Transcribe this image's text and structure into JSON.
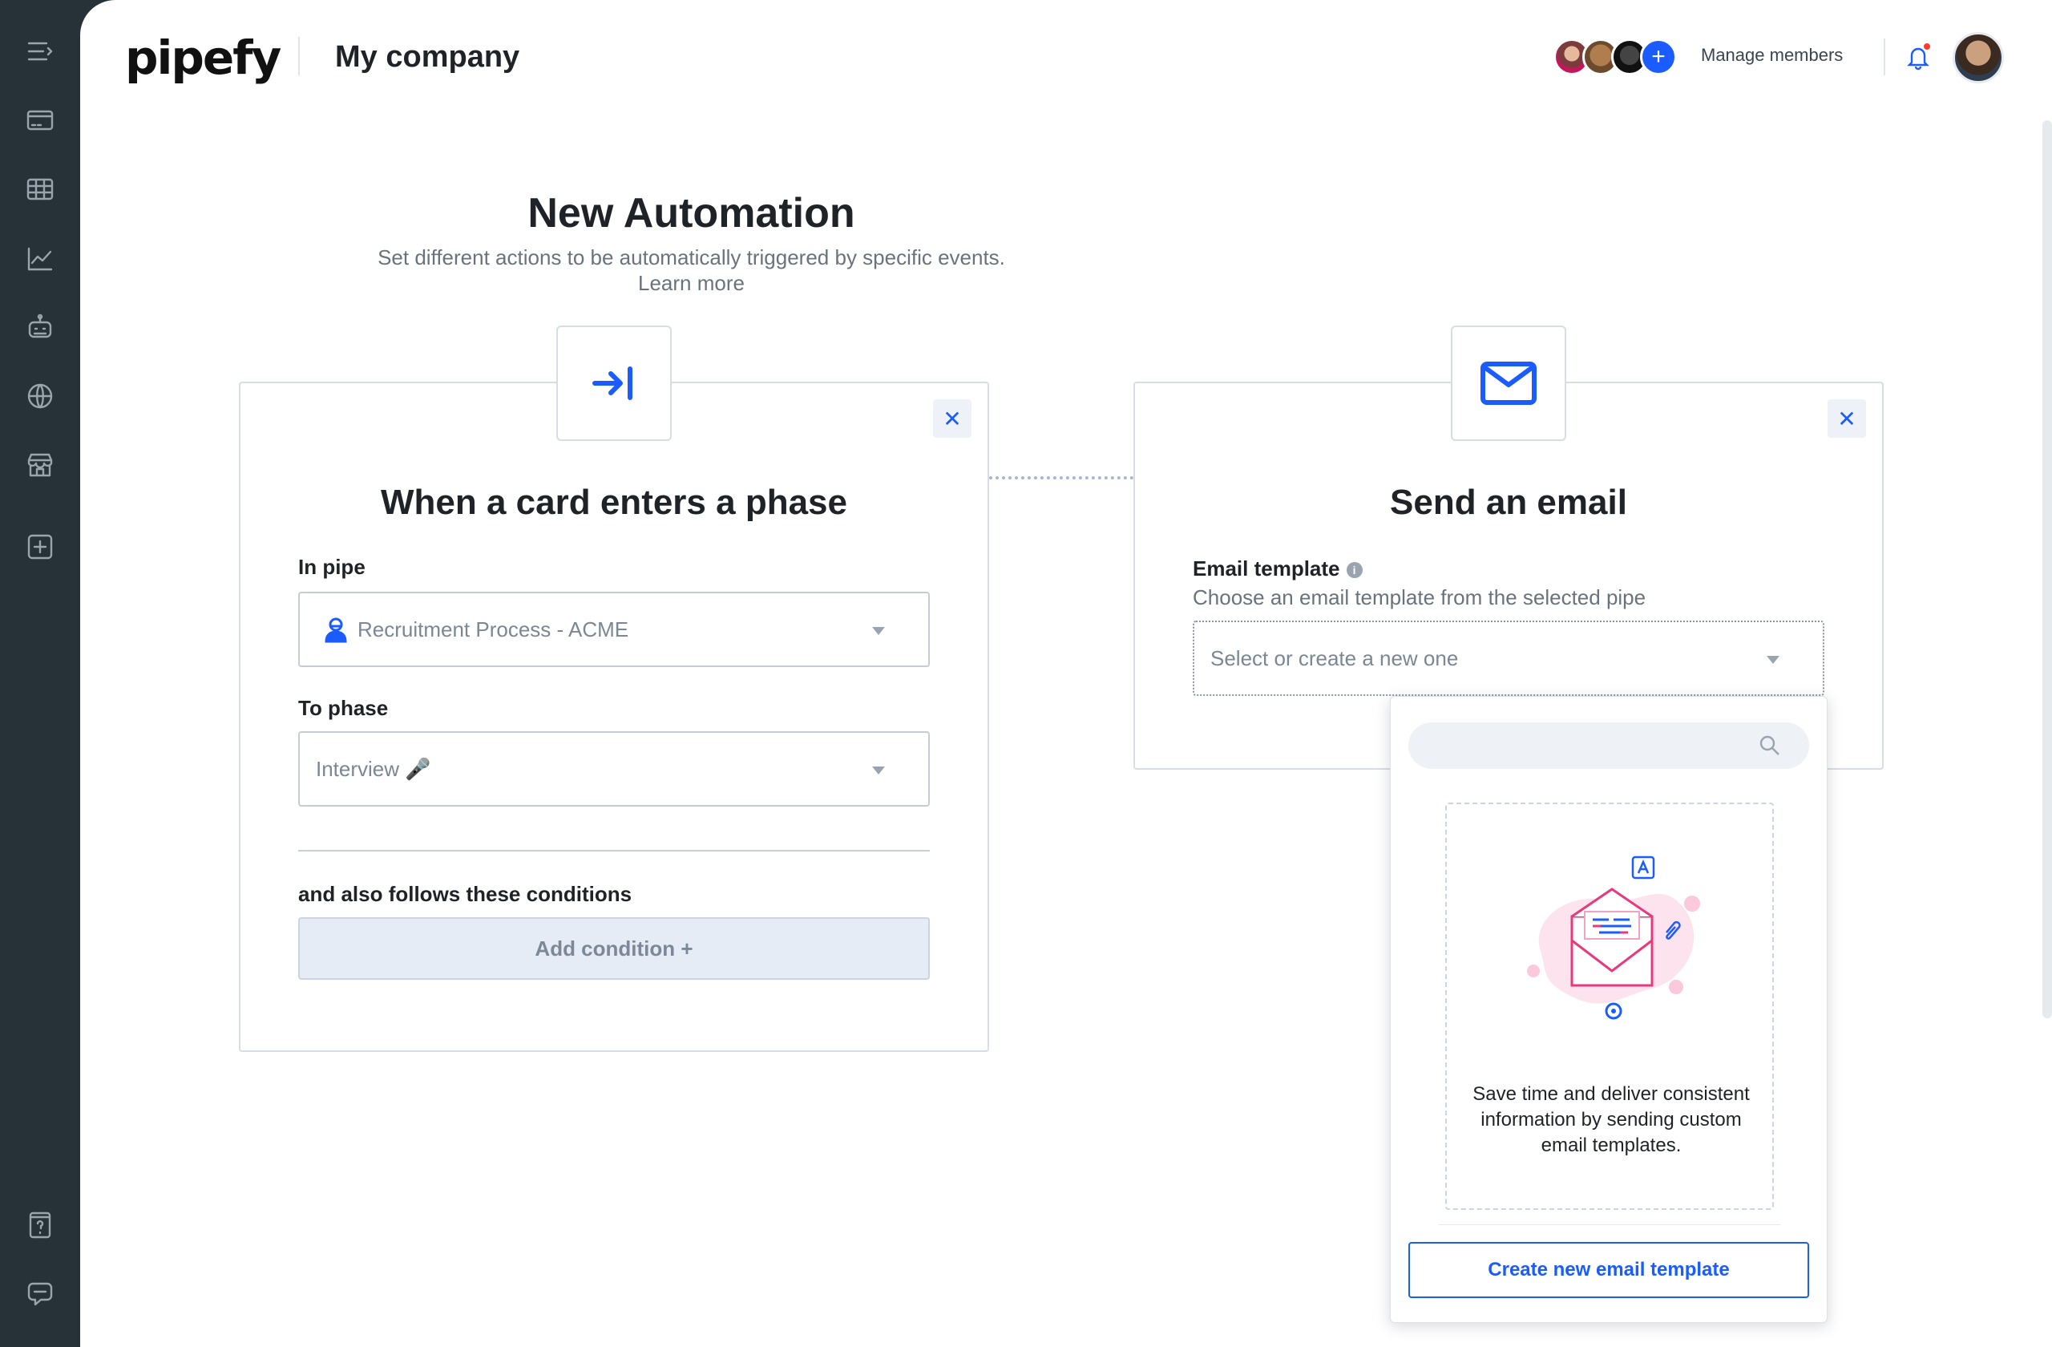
{
  "app": {
    "logo_text": "pipefy",
    "company_name": "My company"
  },
  "sidebar": {
    "items": [
      {
        "icon": "menu-expand-icon"
      },
      {
        "icon": "card-icon"
      },
      {
        "icon": "table-icon"
      },
      {
        "icon": "chart-icon"
      },
      {
        "icon": "robot-icon"
      },
      {
        "icon": "globe-icon"
      },
      {
        "icon": "store-icon"
      },
      {
        "icon": "add-square-icon"
      },
      {
        "icon": "help-icon"
      },
      {
        "icon": "chat-icon"
      }
    ]
  },
  "header": {
    "manage_members": "Manage members",
    "add_member_symbol": "+",
    "notification_dot_color": "#ff3b30"
  },
  "page": {
    "title": "New Automation",
    "subtitle": "Set different actions to be automatically triggered by specific events.",
    "learn_more": "Learn more"
  },
  "trigger": {
    "title": "When a card enters a phase",
    "close_symbol": "✕",
    "pipe_label": "In pipe",
    "pipe_value": "Recruitment Process - ACME",
    "phase_label": "To phase",
    "phase_value": "Interview 🎤",
    "conditions_label": "and also follows these conditions",
    "add_condition": "Add condition +"
  },
  "action": {
    "title": "Send an email",
    "close_symbol": "✕",
    "template_label": "Email template",
    "info_symbol": "i",
    "template_hint": "Choose an email template from the selected pipe",
    "template_placeholder": "Select or create a new one"
  },
  "dropdown": {
    "search_placeholder": "",
    "empty_message": "Save time and deliver consistent information by sending custom email templates.",
    "create_button": "Create new email template"
  },
  "colors": {
    "accent": "#1a5cff",
    "sidebar_bg": "#263238",
    "illustration_pink": "#e8397d"
  }
}
